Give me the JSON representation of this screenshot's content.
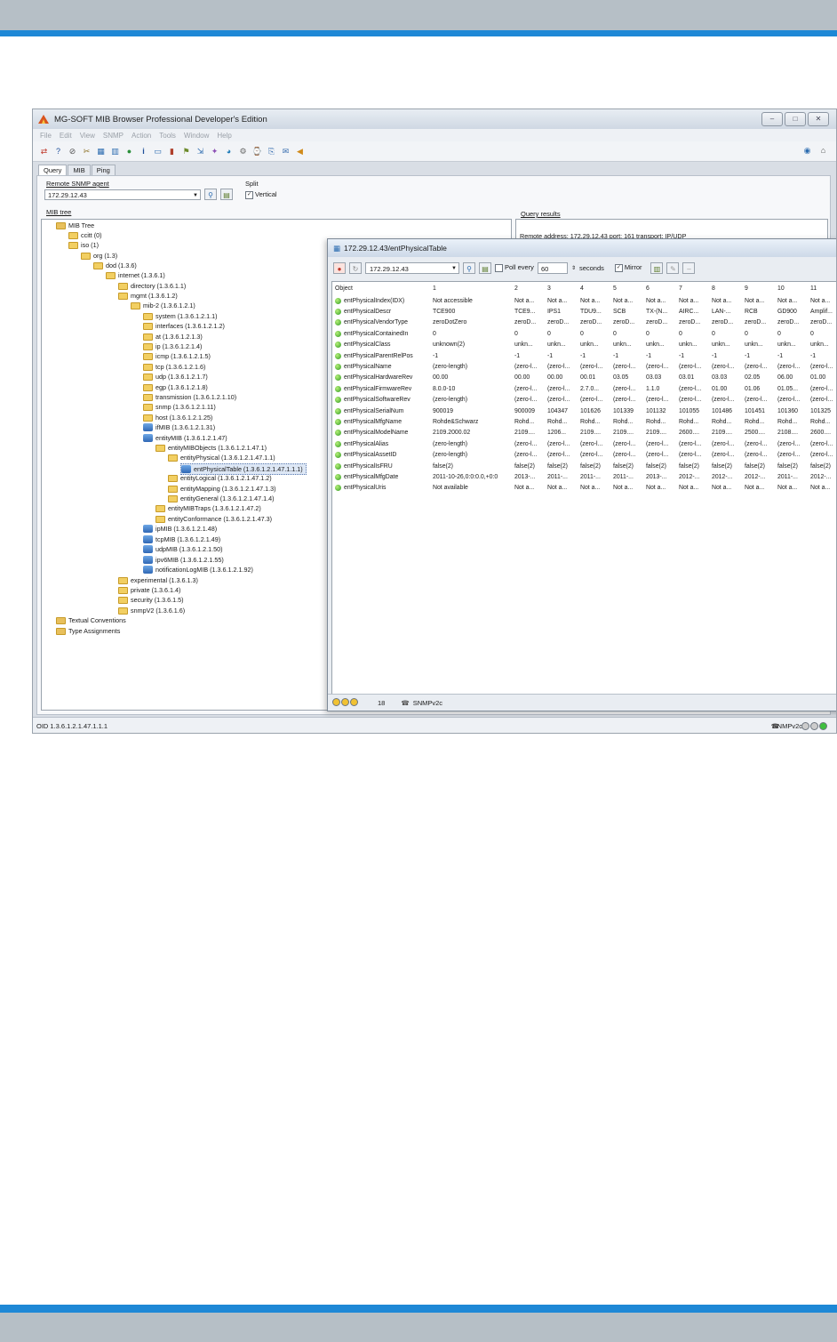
{
  "app": {
    "title": "MG-SOFT MIB Browser Professional Developer's Edition",
    "menu": [
      "File",
      "Edit",
      "View",
      "SNMP",
      "Action",
      "Tools",
      "Window",
      "Help"
    ],
    "toolbar_icons": [
      "connect-icon",
      "query-icon",
      "stop-icon",
      "tools-icon",
      "table-icon",
      "graph-icon",
      "globe-icon",
      "info-icon",
      "window-icon",
      "chart-icon",
      "trap-icon",
      "walk-icon",
      "settings-icon",
      "network-icon",
      "compile-icon",
      "scan-icon",
      "export-icon",
      "bell-icon"
    ]
  },
  "tabs": [
    "Query",
    "MIB",
    "Ping"
  ],
  "query": {
    "remote_label": "Remote SNMP agent",
    "agent": "172.29.12.43",
    "split_label": "Split",
    "vertical_label": "Vertical",
    "mib_tree_label": "MIB tree",
    "results_label": "Query results",
    "results_line": "Remote address: 172.29.12.43  port: 161 transport: IP/UDP"
  },
  "tree": [
    "MIB Tree",
    "ccitt (0)",
    "iso (1)",
    "org (1.3)",
    "dod (1.3.6)",
    "internet (1.3.6.1)",
    "directory (1.3.6.1.1)",
    "mgmt (1.3.6.1.2)",
    "mib-2 (1.3.6.1.2.1)",
    "system (1.3.6.1.2.1.1)",
    "interfaces (1.3.6.1.2.1.2)",
    "at (1.3.6.1.2.1.3)",
    "ip (1.3.6.1.2.1.4)",
    "icmp (1.3.6.1.2.1.5)",
    "tcp (1.3.6.1.2.1.6)",
    "udp (1.3.6.1.2.1.7)",
    "egp (1.3.6.1.2.1.8)",
    "transmission (1.3.6.1.2.1.10)",
    "snmp (1.3.6.1.2.1.11)",
    "host (1.3.6.1.2.1.25)",
    "ifMIB (1.3.6.1.2.1.31)",
    "entityMIB (1.3.6.1.2.1.47)",
    "entityMIBObjects (1.3.6.1.2.1.47.1)",
    "entityPhysical (1.3.6.1.2.1.47.1.1)",
    "entPhysicalTable (1.3.6.1.2.1.47.1.1.1)",
    "entityLogical (1.3.6.1.2.1.47.1.2)",
    "entityMapping (1.3.6.1.2.1.47.1.3)",
    "entityGeneral (1.3.6.1.2.1.47.1.4)",
    "entityMIBTraps (1.3.6.1.2.1.47.2)",
    "entityConformance (1.3.6.1.2.1.47.3)",
    "ipMIB (1.3.6.1.2.1.48)",
    "tcpMIB (1.3.6.1.2.1.49)",
    "udpMIB (1.3.6.1.2.1.50)",
    "ipv6MIB (1.3.6.1.2.1.55)",
    "notificationLogMIB (1.3.6.1.2.1.92)",
    "experimental (1.3.6.1.3)",
    "private (1.3.6.1.4)",
    "security (1.3.6.1.5)",
    "snmpV2 (1.3.6.1.6)",
    "Textual Conventions",
    "Type Assignments"
  ],
  "statusbar": {
    "oid": "OID 1.3.6.1.2.1.47.1.1.1",
    "proto": "SNMPv2c"
  },
  "table_window": {
    "title": "172.29.12.43/entPhysicalTable",
    "agent": "172.29.12.43",
    "poll_label": "Poll every",
    "poll_value": "60",
    "seconds_label": "seconds",
    "mirror_label": "Mirror",
    "count": "18",
    "proto": "SNMPv2c",
    "columns": [
      "Object",
      "1",
      "2",
      "3",
      "4",
      "5",
      "6",
      "7",
      "8",
      "9",
      "10",
      "11"
    ],
    "rows": [
      [
        "entPhysicalIndex(IDX)",
        "Not accessible",
        "Not a...",
        "Not a...",
        "Not a...",
        "Not a...",
        "Not a...",
        "Not a...",
        "Not a...",
        "Not a...",
        "Not a...",
        "Not a..."
      ],
      [
        "entPhysicalDescr",
        "TCE900",
        "TCE9...",
        "IPS1",
        "TDU9...",
        "SCB",
        "TX-(N...",
        "AIRC...",
        "LAN-...",
        "RCB",
        "GD900",
        "Amplif..."
      ],
      [
        "entPhysicalVendorType",
        "zeroDotZero",
        "zeroD...",
        "zeroD...",
        "zeroD...",
        "zeroD...",
        "zeroD...",
        "zeroD...",
        "zeroD...",
        "zeroD...",
        "zeroD...",
        "zeroD..."
      ],
      [
        "entPhysicalContainedIn",
        "0",
        "0",
        "0",
        "0",
        "0",
        "0",
        "0",
        "0",
        "0",
        "0",
        "0"
      ],
      [
        "entPhysicalClass",
        "unknown(2)",
        "unkn...",
        "unkn...",
        "unkn...",
        "unkn...",
        "unkn...",
        "unkn...",
        "unkn...",
        "unkn...",
        "unkn...",
        "unkn..."
      ],
      [
        "entPhysicalParentRelPos",
        "-1",
        "-1",
        "-1",
        "-1",
        "-1",
        "-1",
        "-1",
        "-1",
        "-1",
        "-1",
        "-1"
      ],
      [
        "entPhysicalName",
        "(zero-length)",
        "(zero-l...",
        "(zero-l...",
        "(zero-l...",
        "(zero-l...",
        "(zero-l...",
        "(zero-l...",
        "(zero-l...",
        "(zero-l...",
        "(zero-l...",
        "(zero-l..."
      ],
      [
        "entPhysicalHardwareRev",
        "00.00",
        "00.00",
        "00.00",
        "00.01",
        "03.05",
        "03.03",
        "03.01",
        "03.03",
        "02.05",
        "06.00",
        "01.00"
      ],
      [
        "entPhysicalFirmwareRev",
        "8.0.0-10",
        "(zero-l...",
        "(zero-l...",
        "2.7.0...",
        "(zero-l...",
        "1.1.0",
        "(zero-l...",
        "01.00",
        "01.06",
        "01.05...",
        "(zero-l..."
      ],
      [
        "entPhysicalSoftwareRev",
        "(zero-length)",
        "(zero-l...",
        "(zero-l...",
        "(zero-l...",
        "(zero-l...",
        "(zero-l...",
        "(zero-l...",
        "(zero-l...",
        "(zero-l...",
        "(zero-l...",
        "(zero-l..."
      ],
      [
        "entPhysicalSerialNum",
        "900019",
        "900009",
        "104347",
        "101626",
        "101339",
        "101132",
        "101055",
        "101486",
        "101451",
        "101360",
        "101325"
      ],
      [
        "entPhysicalMfgName",
        "Rohde&Schwarz",
        "Rohd...",
        "Rohd...",
        "Rohd...",
        "Rohd...",
        "Rohd...",
        "Rohd...",
        "Rohd...",
        "Rohd...",
        "Rohd...",
        "Rohd..."
      ],
      [
        "entPhysicalModelName",
        "2109.2000.02",
        "2109....",
        "1206...",
        "2109....",
        "2109....",
        "2109....",
        "2600....",
        "2109....",
        "2500....",
        "2108....",
        "2600...."
      ],
      [
        "entPhysicalAlias",
        "(zero-length)",
        "(zero-l...",
        "(zero-l...",
        "(zero-l...",
        "(zero-l...",
        "(zero-l...",
        "(zero-l...",
        "(zero-l...",
        "(zero-l...",
        "(zero-l...",
        "(zero-l..."
      ],
      [
        "entPhysicalAssetID",
        "(zero-length)",
        "(zero-l...",
        "(zero-l...",
        "(zero-l...",
        "(zero-l...",
        "(zero-l...",
        "(zero-l...",
        "(zero-l...",
        "(zero-l...",
        "(zero-l...",
        "(zero-l..."
      ],
      [
        "entPhysicalIsFRU",
        "false(2)",
        "false(2)",
        "false(2)",
        "false(2)",
        "false(2)",
        "false(2)",
        "false(2)",
        "false(2)",
        "false(2)",
        "false(2)",
        "false(2)"
      ],
      [
        "entPhysicalMfgDate",
        "2011-10-26,0:0:0.0,+0:0",
        "2013-...",
        "2011-...",
        "2011-...",
        "2011-...",
        "2013-...",
        "2012-...",
        "2012-...",
        "2012-...",
        "2011-...",
        "2012-..."
      ],
      [
        "entPhysicalUris",
        "Not available",
        "Not a...",
        "Not a...",
        "Not a...",
        "Not a...",
        "Not a...",
        "Not a...",
        "Not a...",
        "Not a...",
        "Not a...",
        "Not a..."
      ]
    ]
  }
}
